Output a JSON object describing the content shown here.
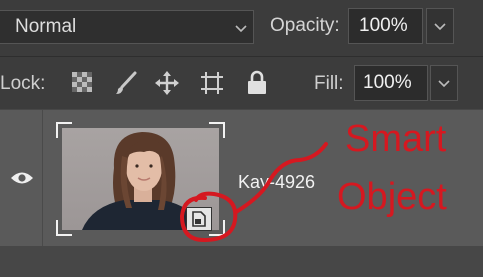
{
  "blend_mode": {
    "value": "Normal"
  },
  "opacity": {
    "label": "Opacity:",
    "value": "100%"
  },
  "lock": {
    "label": "Lock:"
  },
  "fill": {
    "label": "Fill:",
    "value": "100%"
  },
  "layer": {
    "name": "Kay-4926",
    "visible": true,
    "is_smart_object": true
  },
  "annotation": {
    "line1": "Smart",
    "line2": "Object",
    "color": "#d51820"
  },
  "icons": {
    "blend_dropdown": "chevron-down-icon",
    "opacity_dropdown": "chevron-down-icon",
    "fill_dropdown": "chevron-down-icon",
    "lock_transparent": "checkerboard-icon",
    "lock_image": "brush-icon",
    "lock_position": "move-arrows-icon",
    "lock_artboard": "artboard-icon",
    "lock_all": "padlock-icon",
    "visibility": "eye-icon",
    "smart_object_badge": "smart-object-badge-icon"
  }
}
